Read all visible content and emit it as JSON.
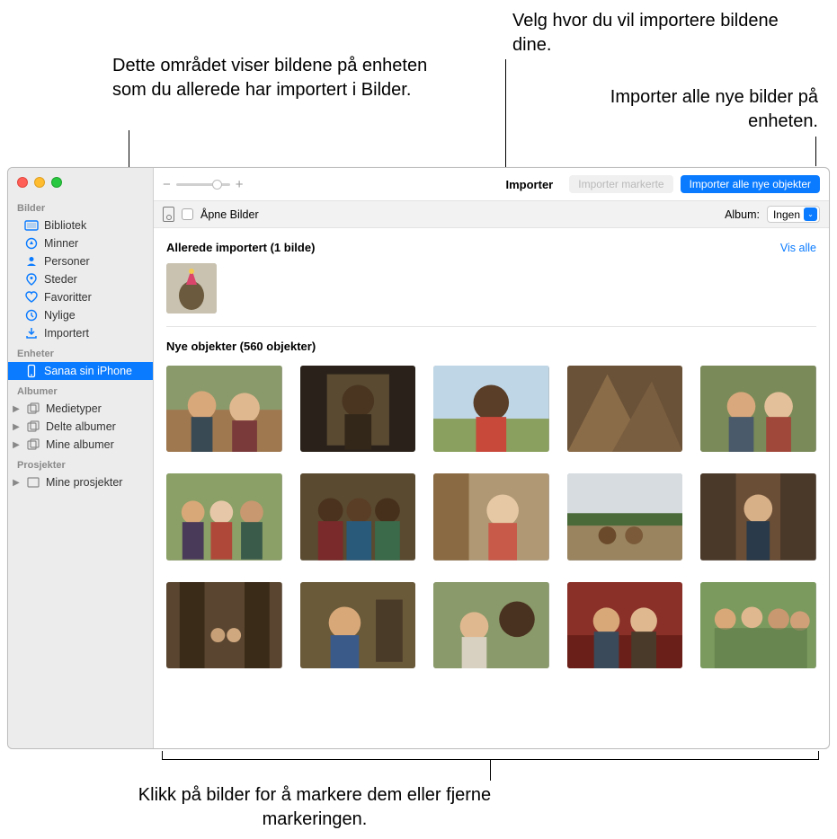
{
  "callouts": {
    "top_left": "Dette området viser bildene på enheten som du allerede har importert i Bilder.",
    "top_right_1": "Velg hvor du vil importere bildene dine.",
    "top_right_2": "Importer alle nye bilder på enheten.",
    "bottom": "Klikk på bilder for å markere dem eller fjerne markeringen."
  },
  "sidebar": {
    "section_bilder": "Bilder",
    "items_bilder": [
      {
        "label": "Bibliotek",
        "icon": "library"
      },
      {
        "label": "Minner",
        "icon": "memories"
      },
      {
        "label": "Personer",
        "icon": "people"
      },
      {
        "label": "Steder",
        "icon": "places"
      },
      {
        "label": "Favoritter",
        "icon": "heart"
      },
      {
        "label": "Nylige",
        "icon": "clock"
      },
      {
        "label": "Importert",
        "icon": "import"
      }
    ],
    "section_enheter": "Enheter",
    "device_label": "Sanaa sin iPhone",
    "section_albumer": "Albumer",
    "items_albumer": [
      {
        "label": "Medietyper"
      },
      {
        "label": "Delte albumer"
      },
      {
        "label": "Mine albumer"
      }
    ],
    "section_prosjekter": "Prosjekter",
    "items_prosjekter": [
      {
        "label": "Mine prosjekter"
      }
    ]
  },
  "toolbar": {
    "title": "Importer",
    "btn_selected": "Importer markerte",
    "btn_all": "Importer alle nye objekter",
    "zoom_minus": "−",
    "zoom_plus": "+"
  },
  "subbar": {
    "open_label": "Åpne Bilder",
    "album_label": "Album:",
    "album_value": "Ingen"
  },
  "content": {
    "imported_title": "Allerede importert (1 bilde)",
    "show_all": "Vis alle",
    "new_title": "Nye objekter (560 objekter)"
  }
}
